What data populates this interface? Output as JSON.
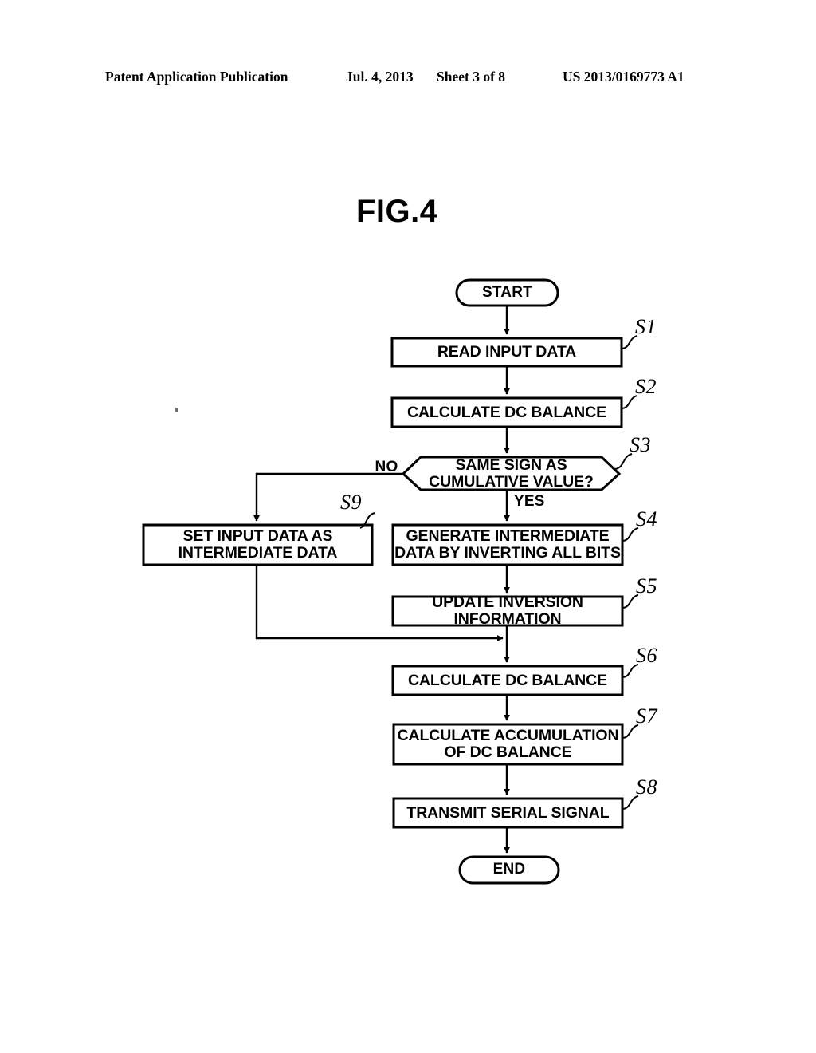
{
  "header": {
    "publication": "Patent Application Publication",
    "date": "Jul. 4, 2013",
    "sheet": "Sheet 3 of 8",
    "patent_number": "US 2013/0169773 A1"
  },
  "figure": {
    "title": "FIG.4"
  },
  "flowchart": {
    "start": {
      "label": "START"
    },
    "end": {
      "label": "END"
    },
    "branches": {
      "no": "NO",
      "yes": "YES"
    },
    "steps": [
      {
        "tag": "S1",
        "label": "READ INPUT DATA",
        "shape": "process"
      },
      {
        "tag": "S2",
        "label": "CALCULATE DC BALANCE",
        "shape": "process"
      },
      {
        "tag": "S3",
        "label": "SAME SIGN AS\nCUMULATIVE VALUE?",
        "shape": "decision"
      },
      {
        "tag": "S9",
        "label": "SET INPUT DATA AS\nINTERMEDIATE DATA",
        "shape": "process"
      },
      {
        "tag": "S4",
        "label": "GENERATE INTERMEDIATE\nDATA BY INVERTING ALL BITS",
        "shape": "process"
      },
      {
        "tag": "S5",
        "label": "UPDATE INVERSION INFORMATION",
        "shape": "process"
      },
      {
        "tag": "S6",
        "label": "CALCULATE DC BALANCE",
        "shape": "process"
      },
      {
        "tag": "S7",
        "label": "CALCULATE ACCUMULATION\nOF DC BALANCE",
        "shape": "process"
      },
      {
        "tag": "S8",
        "label": "TRANSMIT SERIAL SIGNAL",
        "shape": "process"
      }
    ]
  },
  "colors": {
    "ink": "#000000",
    "paper": "#ffffff"
  }
}
